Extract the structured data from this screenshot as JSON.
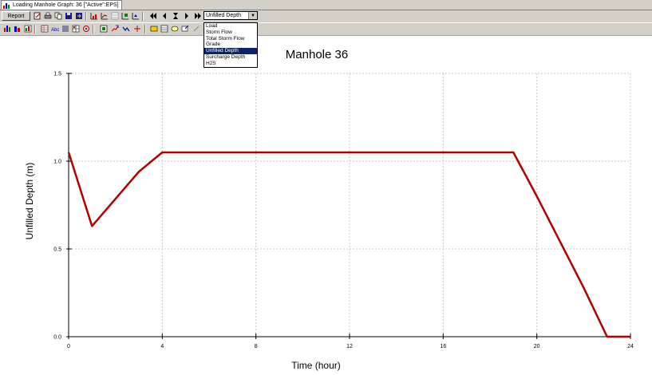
{
  "window": {
    "tab_title": "Loading Manhole Graph: 36 [\"Active\":EPS]"
  },
  "toolbar": {
    "report_label": "Report",
    "variable_select": {
      "selected": "Unfilled Depth",
      "options": [
        "Load",
        "Storm Flow",
        "Total Storm Flow",
        "Grade",
        "Unfilled Depth",
        "Surcharge Depth",
        "H2S"
      ],
      "selected_index": 4
    }
  },
  "colors": {
    "series": "#b00000",
    "toolbar_bg": "#d4d0c8",
    "highlight": "#0a246a",
    "grid": "#c8c8c8"
  },
  "chart_data": {
    "type": "line",
    "title": "Manhole 36",
    "xlabel": "Time (hour)",
    "ylabel": "Unfilled Depth (m)",
    "xlim": [
      0,
      24
    ],
    "ylim": [
      0,
      1.5
    ],
    "xticks": [
      0,
      4,
      8,
      12,
      16,
      20,
      24
    ],
    "xtick_labels": [
      "0",
      "4",
      "8",
      "12",
      "16",
      "20",
      "24"
    ],
    "yticks": [
      0,
      0.5,
      1,
      1.5
    ],
    "ytick_labels": [
      "0.0",
      "0.5",
      "1.0",
      "1.5"
    ],
    "grid": true,
    "series": [
      {
        "x": [
          0,
          1,
          3,
          4,
          19,
          20,
          22,
          23,
          24
        ],
        "y": [
          1.05,
          0.63,
          0.94,
          1.05,
          1.05,
          0.8,
          0.28,
          0.0,
          0.0
        ]
      }
    ]
  }
}
